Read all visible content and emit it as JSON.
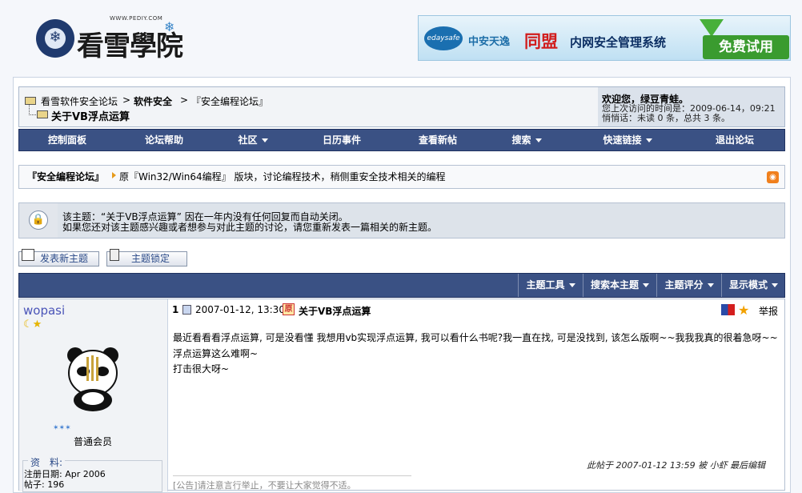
{
  "header": {
    "logo_url": "WWW.PEDIY.COM",
    "logo_text": "看雪學院",
    "ad": {
      "company": "中安天逸",
      "logo_label": "edaysafe",
      "brand": "同盟",
      "product": "内网安全管理系统",
      "cta": "免费试用"
    }
  },
  "breadcrumb": {
    "items": [
      "看雪软件安全论坛",
      "软件安全",
      "『安全编程论坛』"
    ],
    "separator": ">",
    "current": "关于VB浮点运算"
  },
  "user_panel": {
    "welcome": "欢迎您，绿豆青蛙。",
    "last_visit": "您上次访问的时间是：2009-06-14，09:21",
    "pm": "悄悄话：未读 0 条，总共 3 条。"
  },
  "nav": {
    "items": [
      {
        "label": "控制面板",
        "dropdown": false
      },
      {
        "label": "论坛帮助",
        "dropdown": false
      },
      {
        "label": "社区",
        "dropdown": true
      },
      {
        "label": "日历事件",
        "dropdown": false
      },
      {
        "label": "查看新帖",
        "dropdown": false
      },
      {
        "label": "搜索",
        "dropdown": true
      },
      {
        "label": "快速链接",
        "dropdown": true
      },
      {
        "label": "退出论坛",
        "dropdown": false
      }
    ]
  },
  "forum": {
    "title": "『安全编程论坛』",
    "description": "原『Win32/Win64编程』 版块，讨论编程技术，稍侧重安全技术相关的编程"
  },
  "notice": {
    "line1": "该主题：“关于VB浮点运算” 因在一年内没有任何回复而自动关闭。",
    "line2": "如果您还对该主题感兴趣或者想参与对此主题的讨论，请您重新发表一篇相关的新主题。"
  },
  "actions": {
    "new_thread": "发表新主题",
    "locked": "主题锁定"
  },
  "tools": {
    "items": [
      "主题工具",
      "搜索本主题",
      "主题评分",
      "显示模式"
    ]
  },
  "post": {
    "author": "wopasi",
    "rank": "普通会员",
    "profile_title": "资　料:",
    "reg_date": "注册日期: Apr 2006",
    "post_count": "帖子: 196",
    "number": "1",
    "date": "2007-01-12, 13:30",
    "title": "关于VB浮点运算",
    "report": "举报",
    "body_line1": "最近看看看浮点运算, 可是没看懂 我想用vb实现浮点运算, 我可以看什么书呢?我一直在找, 可是没找到, 该怎么版啊~~我我我真的很着急呀~~浮点运算这么难啊~",
    "body_line2": "打击很大呀~",
    "edited": "此帖于 2007-01-12 13:59 被 小虾 最后编辑",
    "signature": "[公告]请注意言行举止，不要让大家觉得不适。"
  },
  "colors": {
    "nav_bg": "#3a5184",
    "author_color": "#4a54b8",
    "page_bg": "#f5f7fb"
  }
}
